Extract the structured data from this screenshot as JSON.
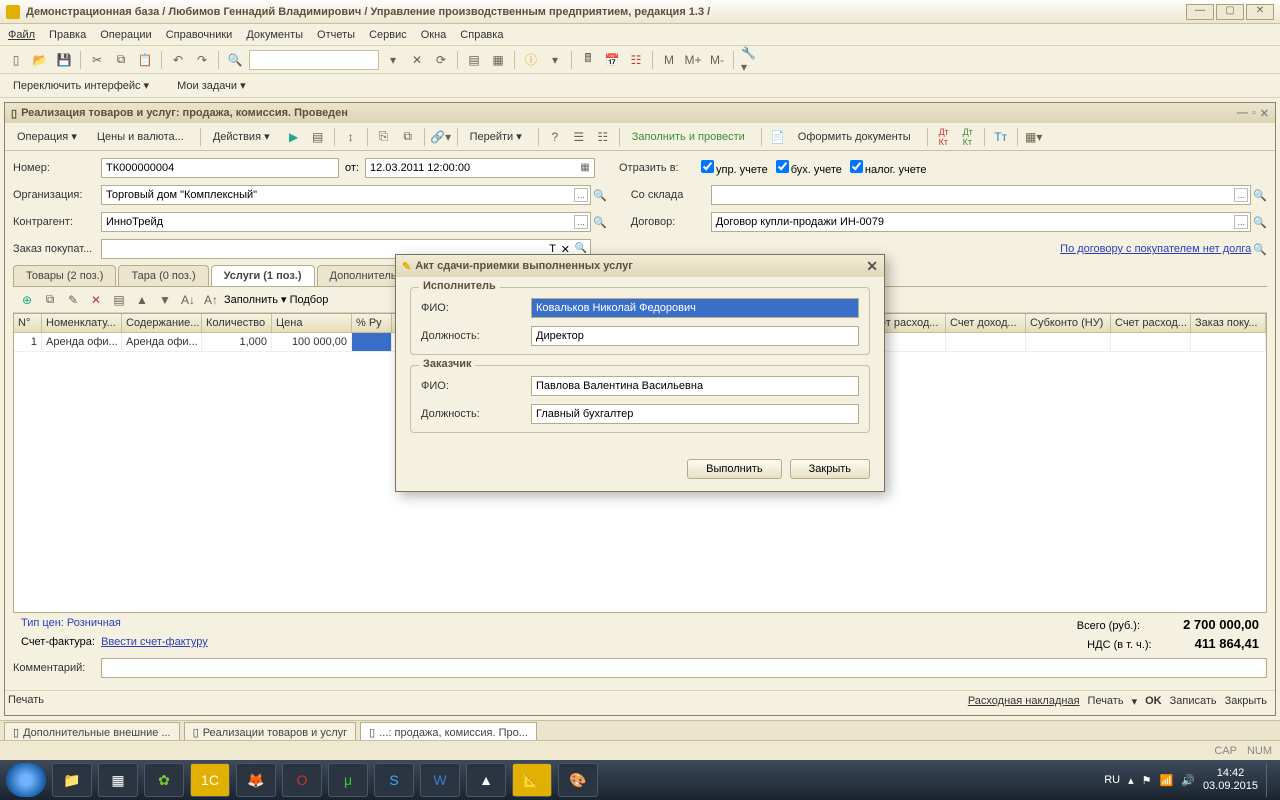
{
  "title": "Демонстрационная база / Любимов Геннадий Владимирович / Управление производственным предприятием, редакция 1.3 /",
  "menu": [
    "Файл",
    "Правка",
    "Операции",
    "Справочники",
    "Документы",
    "Отчеты",
    "Сервис",
    "Окна",
    "Справка"
  ],
  "toolbar2": {
    "switch": "Переключить интерфейс ▾",
    "tasks": "Мои задачи ▾"
  },
  "doc": {
    "title": "Реализация товаров и услуг: продажа, комиссия. Проведен",
    "tb": {
      "operation": "Операция ▾",
      "prices": "Цены и валюта...",
      "actions": "Действия ▾",
      "goto": "Перейти ▾",
      "fill": "Заполнить и провести",
      "make": "Оформить документы"
    },
    "form": {
      "num_lbl": "Номер:",
      "num": "ТК000000004",
      "ot": "от:",
      "date": "12.03.2011 12:00:00",
      "otr_lbl": "Отразить в:",
      "cb1": "упр. учете",
      "cb2": "бух. учете",
      "cb3": "налог. учете",
      "org_lbl": "Организация:",
      "org": "Торговый дом \"Комплексный\"",
      "sklad_lbl": "Со склада",
      "kontr_lbl": "Контрагент:",
      "kontr": "ИнноТрейд",
      "dog_lbl": "Договор:",
      "dog": "Договор купли-продажи ИН-0079",
      "zakaz_lbl": "Заказ покупат...",
      "nodebt": "По договору с покупателем нет долга"
    },
    "tabs": [
      "Товары (2 поз.)",
      "Тара (0 поз.)",
      "Услуги (1 поз.)",
      "Дополнительно"
    ],
    "tabtb": {
      "fill": "Заполнить ▾",
      "select": "Подбор"
    },
    "grid": {
      "headers": [
        "N°",
        "Номенклату...",
        "Содержание...",
        "Количество",
        "Цена",
        "% Ру",
        "",
        "",
        "",
        "",
        "ет расход...",
        "Счет доход...",
        "Субконто (НУ)",
        "Счет расход...",
        "Заказ поку..."
      ],
      "row": {
        "n": "1",
        "nom": "Аренда офи...",
        "sod": "Аренда офи...",
        "qty": "1,000",
        "price": "100 000,00"
      }
    },
    "price_type_lbl": "Тип цен:",
    "price_type": "Розничная",
    "total_lbl": "Всего (руб.):",
    "total": "2 700 000,00",
    "nds_lbl": "НДС (в т. ч.):",
    "nds": "411 864,41",
    "sf_lbl": "Счет-фактура:",
    "sf_link": "Ввести счет-фактуру",
    "comment_lbl": "Комментарий:",
    "actions": [
      "Расходная накладная",
      "Печать",
      "OK",
      "Записать",
      "Закрыть"
    ]
  },
  "dialog": {
    "title": "Акт сдачи-приемки выполненных услуг",
    "exec_leg": "Исполнитель",
    "fio_lbl": "ФИО:",
    "exec_fio": "Ковальков Николай Федорович",
    "pos_lbl": "Должность:",
    "exec_pos": "Директор",
    "cust_leg": "Заказчик",
    "cust_fio": "Павлова Валентина Васильевна",
    "cust_pos": "Главный бухгалтер",
    "ok": "Выполнить",
    "cancel": "Закрыть"
  },
  "wtabs": [
    "Дополнительные внешние ...",
    "Реализации товаров и услуг",
    "...: продажа, комиссия. Про..."
  ],
  "status": {
    "cap": "CAP",
    "num": "NUM"
  },
  "tray": {
    "lang": "RU",
    "time": "14:42",
    "date": "03.09.2015"
  },
  "ftr_print": "Печать"
}
